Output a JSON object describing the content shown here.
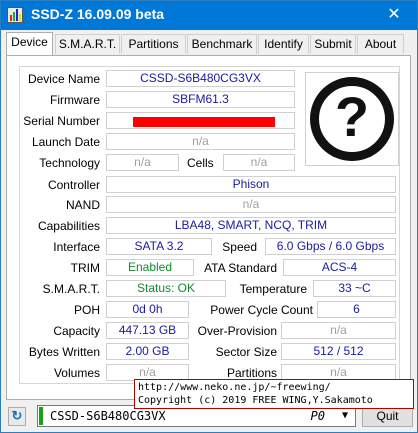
{
  "window": {
    "title": "SSD-Z 16.09.09 beta",
    "close_glyph": "✕"
  },
  "tabs": [
    {
      "label": "Device",
      "active": true
    },
    {
      "label": "S.M.A.R.T.",
      "active": false
    },
    {
      "label": "Partitions",
      "active": false
    },
    {
      "label": "Benchmark",
      "active": false
    },
    {
      "label": "Identify",
      "active": false
    },
    {
      "label": "Submit",
      "active": false
    },
    {
      "label": "About",
      "active": false
    }
  ],
  "device": {
    "device_name": {
      "label": "Device Name",
      "value": "CSSD-S6B480CG3VX"
    },
    "firmware": {
      "label": "Firmware",
      "value": "SBFM61.3"
    },
    "serial_number": {
      "label": "Serial Number",
      "value": ""
    },
    "launch_date": {
      "label": "Launch Date",
      "value": "n/a"
    },
    "technology": {
      "label": "Technology",
      "value": "n/a"
    },
    "cells": {
      "label": "Cells",
      "value": "n/a"
    },
    "controller": {
      "label": "Controller",
      "value": "Phison"
    },
    "nand": {
      "label": "NAND",
      "value": "n/a"
    },
    "capabilities": {
      "label": "Capabilities",
      "value": "LBA48, SMART, NCQ, TRIM"
    },
    "interface": {
      "label": "Interface",
      "value": "SATA 3.2"
    },
    "speed": {
      "label": "Speed",
      "value": "6.0 Gbps / 6.0 Gbps"
    },
    "trim": {
      "label": "TRIM",
      "value": "Enabled"
    },
    "ata_standard": {
      "label": "ATA Standard",
      "value": "ACS-4"
    },
    "smart": {
      "label": "S.M.A.R.T.",
      "value": "Status: OK"
    },
    "temperature": {
      "label": "Temperature",
      "value": "33 ~C"
    },
    "poh": {
      "label": "POH",
      "value": "0d 0h"
    },
    "power_cycle_count": {
      "label": "Power Cycle Count",
      "value": "6"
    },
    "capacity": {
      "label": "Capacity",
      "value": "447.13 GB"
    },
    "over_provision": {
      "label": "Over-Provision",
      "value": "n/a"
    },
    "bytes_written": {
      "label": "Bytes Written",
      "value": "2.00 GB"
    },
    "sector_size": {
      "label": "Sector Size",
      "value": "512 / 512"
    },
    "volumes": {
      "label": "Volumes",
      "value": "n/a"
    },
    "partitions": {
      "label": "Partitions",
      "value": "n/a"
    }
  },
  "unknown_image": {
    "glyph": "?"
  },
  "overlay": {
    "line1": "http://www.neko.ne.jp/~freewing/",
    "line2": "Copyright (c) 2019 FREE WING,Y.Sakamoto"
  },
  "bottom": {
    "drive_value": "CSSD-S6B480CG3VX",
    "drive_port": "P0",
    "quit_label": "Quit"
  },
  "colors": {
    "titlebar": "#0078d7",
    "value_text": "#1a1aa0",
    "na_text": "#a0a0a0",
    "green_text": "#138a2c",
    "redacted": "#ff0000"
  }
}
